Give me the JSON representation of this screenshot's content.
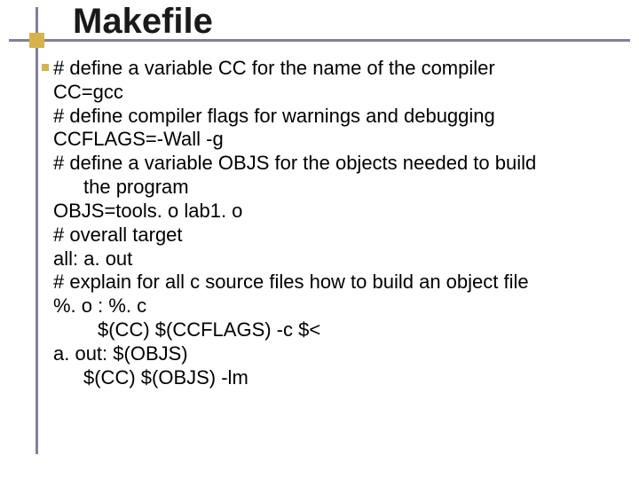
{
  "title": "Makefile",
  "lines": {
    "l0": "# define a variable CC for the name of the compiler",
    "l1": "CC=gcc",
    "l2": "# define compiler flags for warnings and debugging",
    "l3": "CCFLAGS=-Wall -g",
    "l4": "# define a variable OBJS  for the objects needed to build",
    "l4b": "the program",
    "l5": "OBJS=tools. o lab1. o",
    "l6": "# overall target",
    "l7": "all:   a. out",
    "l8": "# explain for all c source files how to build an object file",
    "l9": "%. o : %. c",
    "l10": "$(CC) $(CCFLAGS) -c $<",
    "l11": "a. out:  $(OBJS)",
    "l12": "$(CC) $(OBJS)  -lm"
  }
}
